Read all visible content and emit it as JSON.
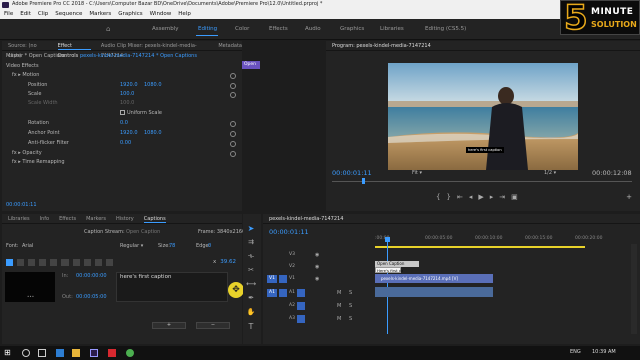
{
  "window": {
    "title": "Adobe Premiere Pro CC 2018 - C:\\Users\\Computer Bazar BD\\OneDrive\\Documents\\Adobe\\Premiere Pro\\12.0\\Untitled.prproj *"
  },
  "menu": [
    "File",
    "Edit",
    "Clip",
    "Sequence",
    "Markers",
    "Graphics",
    "Window",
    "Help"
  ],
  "workspaces": [
    "Assembly",
    "Editing",
    "Color",
    "Effects",
    "Audio",
    "Graphics",
    "Libraries",
    "Editing (CS5.5)"
  ],
  "watermark": {
    "digit": "5",
    "line1": "MINUTE",
    "line2": "SOLUTION"
  },
  "source_panel": {
    "tabs": [
      "Source: (no clips)",
      "Effect Controls",
      "Audio Clip Mixer: pexels-kindel-media-7147214",
      "Metadata"
    ],
    "clip_header": "Master * Open Captions",
    "clip_target": "pexels-kindel-media-7147214 * Open Captions",
    "mini_clip": "Open",
    "section": "Video Effects",
    "motion": "Motion",
    "params": [
      {
        "name": "Position",
        "v1": "1920.0",
        "v2": "1080.0"
      },
      {
        "name": "Scale",
        "v1": "100.0",
        "v2": ""
      },
      {
        "name": "Scale Width",
        "v1": "100.0",
        "v2": ""
      },
      {
        "name": "",
        "v1": "Uniform Scale",
        "v2": ""
      },
      {
        "name": "Rotation",
        "v1": "0.0",
        "v2": ""
      },
      {
        "name": "Anchor Point",
        "v1": "1920.0",
        "v2": "1080.0"
      },
      {
        "name": "Anti-flicker Filter",
        "v1": "0.00",
        "v2": ""
      }
    ],
    "opacity": "Opacity",
    "time_remap": "Time Remapping",
    "timecode": "00:00:01:11"
  },
  "program": {
    "title": "Program: pexels-kindel-media-7147214",
    "caption": "here's first caption",
    "timecode": "00:00:01:11",
    "fit": "Fit",
    "quality": "1/2",
    "duration": "00:00:12:08"
  },
  "captions_panel": {
    "tabs": [
      "Libraries",
      "Info",
      "Effects",
      "Markers",
      "History",
      "Captions"
    ],
    "stream_label": "Caption Stream:",
    "stream_value": "Open Caption",
    "frame": "Frame: 3840x2160",
    "font_label": "Font:",
    "font": "Arial",
    "style": "Regular",
    "size_label": "Size:",
    "size": "78",
    "edge_label": "Edge:",
    "edge": "0",
    "pos_x": "x",
    "pos_val": "39.62",
    "in_label": "In:",
    "in_tc": "00:00:00:00",
    "out_label": "Out:",
    "out_tc": "00:00:05:00",
    "caption_text": "here's first caption",
    "add_btn": "+",
    "remove_btn": "−"
  },
  "timeline": {
    "title": "pexels-kindel-media-7147214",
    "timecode": "00:00:01:11",
    "ruler": [
      ":00:00",
      "00:00:05:00",
      "00:00:10:00",
      "00:00:15:00",
      "00:00:20:00"
    ],
    "tracks": [
      "V3",
      "V2",
      "V1",
      "A1",
      "A2",
      "A3"
    ],
    "src_v": "V1",
    "src_a": "A1",
    "caption_clip": "Open Caption",
    "caption_tooltip": "Here's first ca",
    "video_clip": "pexels-kindel-media-7147214.mp4 [V]"
  },
  "taskbar": {
    "time": "10:39 AM",
    "lang": "ENG"
  },
  "colors": {
    "accent": "#3b9cff",
    "clip_blue": "#5a6fb8",
    "watermark": "#e8a91b"
  }
}
